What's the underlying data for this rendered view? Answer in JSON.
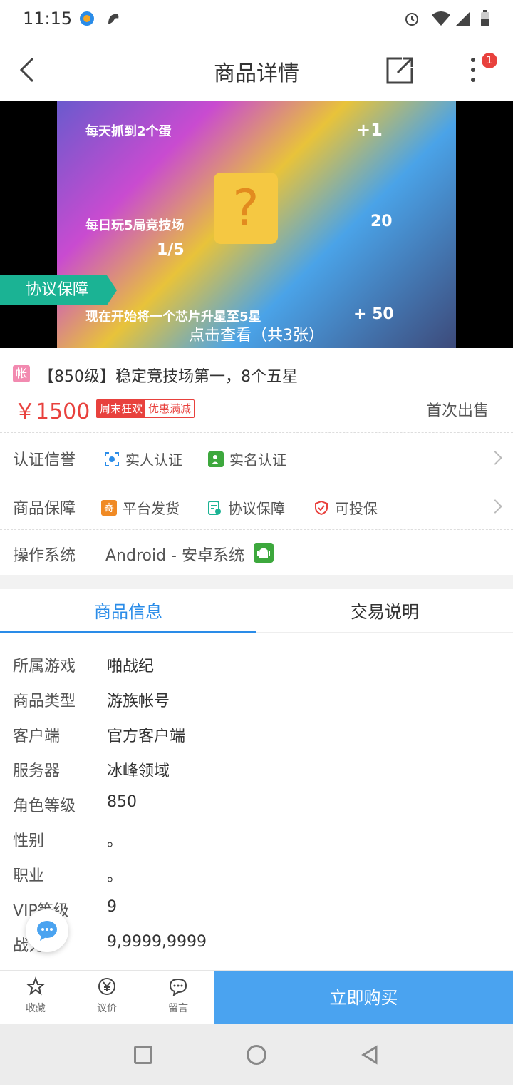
{
  "status_bar": {
    "time": "11:15"
  },
  "nav": {
    "title": "商品详情",
    "notification_count": "1"
  },
  "banner": {
    "protection_tag": "协议保障",
    "view_text": "点击查看（共3张）",
    "overlay_texts": [
      "每天抓到2个蛋",
      "每日玩5局竞技场",
      "1/5",
      "20",
      "现在开始将一个芯片升星至5星",
      "+ 50",
      "+1"
    ]
  },
  "product": {
    "account_badge": "帐",
    "title": "【850级】稳定竞技场第一，8个五星",
    "price": "￥1500",
    "promo_tags": [
      "周末狂欢",
      "优惠满减"
    ],
    "first_sale": "首次出售"
  },
  "certification": {
    "label": "认证信誉",
    "items": [
      "实人认证",
      "实名认证"
    ]
  },
  "guarantee": {
    "label": "商品保障",
    "items": [
      "平台发货",
      "协议保障",
      "可投保"
    ],
    "ship_icon_char": "寄"
  },
  "os": {
    "label": "操作系统",
    "value": "Android - 安卓系统"
  },
  "tabs": [
    {
      "label": "商品信息",
      "active": true
    },
    {
      "label": "交易说明",
      "active": false
    }
  ],
  "info_rows": [
    {
      "key": "所属游戏",
      "value": "啪战纪"
    },
    {
      "key": "商品类型",
      "value": "游族帐号"
    },
    {
      "key": "客户端",
      "value": "官方客户端"
    },
    {
      "key": "服务器",
      "value": "冰峰领域"
    },
    {
      "key": "角色等级",
      "value": "850"
    },
    {
      "key": "性别",
      "value": "。"
    },
    {
      "key": "职业",
      "value": "。"
    },
    {
      "key": "VIP等级",
      "value": "9"
    },
    {
      "key": "战力",
      "value": "9,9999,9999"
    }
  ],
  "bottom_bar": {
    "favorite": "收藏",
    "bargain": "议价",
    "message": "留言",
    "buy": "立即购买"
  },
  "colors": {
    "accent_blue": "#2a8ce8",
    "price_red": "#e8413d",
    "protect_green": "#1bb394",
    "buy_blue": "#4aa3f0"
  }
}
